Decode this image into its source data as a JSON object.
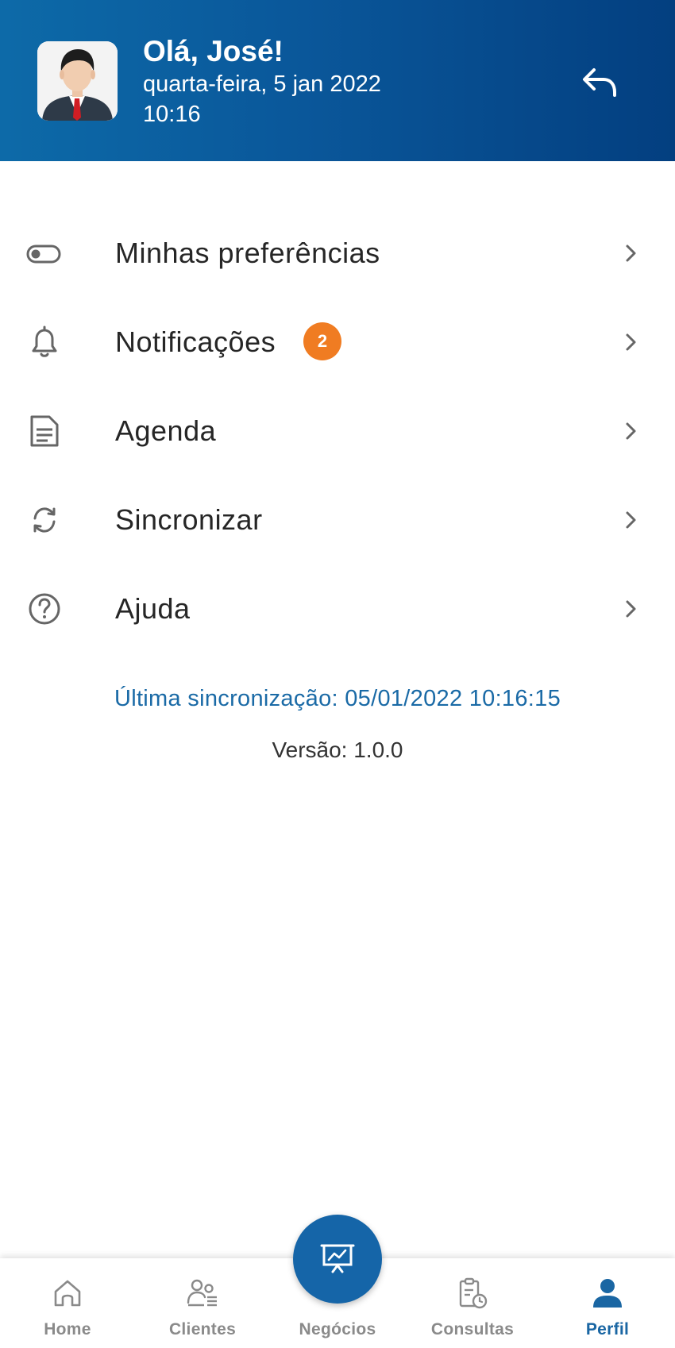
{
  "header": {
    "greeting": "Olá, José!",
    "date": "quarta-feira, 5 jan 2022",
    "time": "10:16",
    "avatar_icon": "user-avatar-icon",
    "back_icon": "reply-arrow-icon",
    "gradient_colors": [
      "#0d6aa8",
      "#033f80"
    ]
  },
  "menu": {
    "items": [
      {
        "label": "Minhas preferências",
        "icon": "toggle-icon"
      },
      {
        "label": "Notificações",
        "icon": "bell-icon",
        "badge": "2"
      },
      {
        "label": "Agenda",
        "icon": "document-icon"
      },
      {
        "label": "Sincronizar",
        "icon": "sync-icon"
      },
      {
        "label": "Ajuda",
        "icon": "help-circle-icon"
      }
    ]
  },
  "sync": {
    "last_sync": "Última sincronização: 05/01/2022 10:16:15"
  },
  "version": {
    "text": "Versão: 1.0.0"
  },
  "bottom_nav": {
    "items": [
      {
        "label": "Home",
        "icon": "home-icon"
      },
      {
        "label": "Clientes",
        "icon": "clients-icon"
      },
      {
        "label": "Negócios",
        "icon": "presentation-chart-icon"
      },
      {
        "label": "Consultas",
        "icon": "clipboard-clock-icon"
      },
      {
        "label": "Perfil",
        "icon": "person-icon",
        "active": true
      }
    ]
  },
  "colors": {
    "accent": "#1565a8",
    "badge": "#f07c22",
    "sync_text": "#1a6aa6",
    "inactive_nav": "#8a8a8a"
  }
}
